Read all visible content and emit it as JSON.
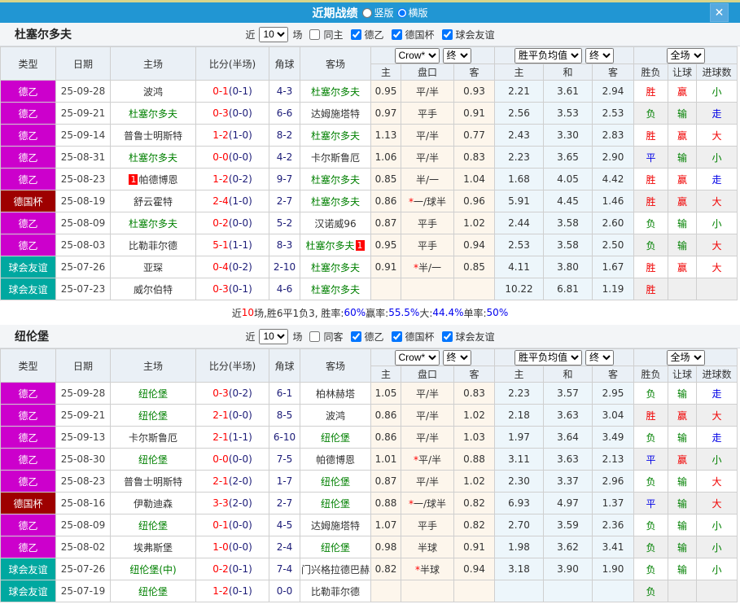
{
  "titlebar": {
    "title": "近期战绩",
    "radio_vertical": "竖版",
    "radio_horizontal": "横版",
    "close_glyph": "✕"
  },
  "type_colors": {
    "德乙": "#CC00CC",
    "德国杯": "#9E0000",
    "球会友谊": "#00A8A0"
  },
  "result_colors": {
    "胜": "#F00000",
    "负": "#008000",
    "平": "#0000E6",
    "赢": "#F00000",
    "输": "#008000",
    "走": "#0000E6",
    "大": "#F00000",
    "小": "#008000"
  },
  "table_header": {
    "cols": [
      "类型",
      "日期",
      "主场",
      "比分(半场)",
      "角球",
      "客场"
    ],
    "odds_select": "Crow*",
    "odds_final": "终",
    "mean_select": "胜平负均值",
    "mean_final": "终",
    "scope_select": "全场",
    "sub": [
      "主",
      "盘口",
      "客",
      "主",
      "和",
      "客",
      "胜负",
      "让球",
      "进球数"
    ]
  },
  "sections": [
    {
      "team": "杜塞尔多夫",
      "filter": {
        "near": "近",
        "games": "10",
        "games_unit": "场",
        "same": "同主",
        "same_checked": false,
        "leagues": [
          {
            "label": "德乙",
            "checked": true
          },
          {
            "label": "德国杯",
            "checked": true
          },
          {
            "label": "球会友谊",
            "checked": true
          }
        ]
      },
      "rows": [
        {
          "type": "德乙",
          "date": "25-09-28",
          "home": "波鸿",
          "home_focus": false,
          "score": "0-1",
          "half": "(0-1)",
          "corner": "4-3",
          "away": "杜塞尔多夫",
          "away_focus": true,
          "odds": [
            "0.95",
            "平/半",
            "0.93"
          ],
          "means": [
            "2.21",
            "3.61",
            "2.94"
          ],
          "results": [
            "胜",
            "赢",
            "小"
          ]
        },
        {
          "type": "德乙",
          "date": "25-09-21",
          "home": "杜塞尔多夫",
          "home_focus": true,
          "score": "0-3",
          "half": "(0-0)",
          "corner": "6-6",
          "away": "达姆施塔特",
          "away_focus": false,
          "odds": [
            "0.97",
            "平手",
            "0.91"
          ],
          "means": [
            "2.56",
            "3.53",
            "2.53"
          ],
          "results": [
            "负",
            "输",
            "走"
          ]
        },
        {
          "type": "德乙",
          "date": "25-09-14",
          "home": "普鲁士明斯特",
          "home_focus": false,
          "score": "1-2",
          "half": "(1-0)",
          "corner": "8-2",
          "away": "杜塞尔多夫",
          "away_focus": true,
          "odds": [
            "1.13",
            "平/半",
            "0.77"
          ],
          "means": [
            "2.43",
            "3.30",
            "2.83"
          ],
          "results": [
            "胜",
            "赢",
            "大"
          ]
        },
        {
          "type": "德乙",
          "date": "25-08-31",
          "home": "杜塞尔多夫",
          "home_focus": true,
          "score": "0-0",
          "half": "(0-0)",
          "corner": "4-2",
          "away": "卡尔斯鲁厄",
          "away_focus": false,
          "odds": [
            "1.06",
            "平/半",
            "0.83"
          ],
          "means": [
            "2.23",
            "3.65",
            "2.90"
          ],
          "results": [
            "平",
            "输",
            "小"
          ]
        },
        {
          "type": "德乙",
          "date": "25-08-23",
          "home": "帕德博恩",
          "home_focus": false,
          "home_badge": "1",
          "home_badge_pos": "before",
          "score": "1-2",
          "half": "(0-2)",
          "corner": "9-7",
          "away": "杜塞尔多夫",
          "away_focus": true,
          "odds": [
            "0.85",
            "半/一",
            "1.04"
          ],
          "means": [
            "1.68",
            "4.05",
            "4.42"
          ],
          "results": [
            "胜",
            "赢",
            "走"
          ]
        },
        {
          "type": "德国杯",
          "date": "25-08-19",
          "home": "舒云霍特",
          "home_focus": false,
          "score": "2-4",
          "half": "(1-0)",
          "corner": "2-7",
          "away": "杜塞尔多夫",
          "away_focus": true,
          "odds": [
            "0.86",
            "*一/球半",
            "0.96"
          ],
          "means": [
            "5.91",
            "4.45",
            "1.46"
          ],
          "results": [
            "胜",
            "赢",
            "大"
          ]
        },
        {
          "type": "德乙",
          "date": "25-08-09",
          "home": "杜塞尔多夫",
          "home_focus": true,
          "score": "0-2",
          "half": "(0-0)",
          "corner": "5-2",
          "away": "汉诺威96",
          "away_focus": false,
          "odds": [
            "0.87",
            "平手",
            "1.02"
          ],
          "means": [
            "2.44",
            "3.58",
            "2.60"
          ],
          "results": [
            "负",
            "输",
            "小"
          ]
        },
        {
          "type": "德乙",
          "date": "25-08-03",
          "home": "比勒菲尔德",
          "home_focus": false,
          "score": "5-1",
          "half": "(1-1)",
          "corner": "8-3",
          "away": "杜塞尔多夫",
          "away_focus": true,
          "away_badge": "1",
          "away_badge_pos": "after",
          "odds": [
            "0.95",
            "平手",
            "0.94"
          ],
          "means": [
            "2.53",
            "3.58",
            "2.50"
          ],
          "results": [
            "负",
            "输",
            "大"
          ]
        },
        {
          "type": "球会友谊",
          "date": "25-07-26",
          "home": "亚琛",
          "home_focus": false,
          "score": "0-4",
          "half": "(0-2)",
          "corner": "2-10",
          "away": "杜塞尔多夫",
          "away_focus": true,
          "odds": [
            "0.91",
            "*半/一",
            "0.85"
          ],
          "means": [
            "4.11",
            "3.80",
            "1.67"
          ],
          "results": [
            "胜",
            "赢",
            "大"
          ]
        },
        {
          "type": "球会友谊",
          "date": "25-07-23",
          "home": "威尔伯特",
          "home_focus": false,
          "score": "0-3",
          "half": "(0-1)",
          "corner": "4-6",
          "away": "杜塞尔多夫",
          "away_focus": true,
          "odds": [
            "",
            "",
            ""
          ],
          "means": [
            "10.22",
            "6.81",
            "1.19"
          ],
          "results": [
            "胜",
            "",
            ""
          ]
        }
      ],
      "summary": [
        {
          "text": "近",
          "color": "#333333"
        },
        {
          "text": "10",
          "color": "#FF0000"
        },
        {
          "text": "场,胜6平1负3, 胜率:",
          "color": "#333333"
        },
        {
          "text": "60%",
          "color": "#0000EE"
        },
        {
          "text": " 赢率:",
          "color": "#333333"
        },
        {
          "text": "55.5%",
          "color": "#0000EE"
        },
        {
          "text": " 大:",
          "color": "#333333"
        },
        {
          "text": "44.4%",
          "color": "#0000EE"
        },
        {
          "text": " 单率:",
          "color": "#333333"
        },
        {
          "text": "50%",
          "color": "#0000EE"
        }
      ]
    },
    {
      "team": "纽伦堡",
      "filter": {
        "near": "近",
        "games": "10",
        "games_unit": "场",
        "same": "同客",
        "same_checked": false,
        "leagues": [
          {
            "label": "德乙",
            "checked": true
          },
          {
            "label": "德国杯",
            "checked": true
          },
          {
            "label": "球会友谊",
            "checked": true
          }
        ]
      },
      "rows": [
        {
          "type": "德乙",
          "date": "25-09-28",
          "home": "纽伦堡",
          "home_focus": true,
          "score": "0-3",
          "half": "(0-2)",
          "corner": "6-1",
          "away": "柏林赫塔",
          "away_focus": false,
          "odds": [
            "1.05",
            "平/半",
            "0.83"
          ],
          "means": [
            "2.23",
            "3.57",
            "2.95"
          ],
          "results": [
            "负",
            "输",
            "走"
          ]
        },
        {
          "type": "德乙",
          "date": "25-09-21",
          "home": "纽伦堡",
          "home_focus": true,
          "score": "2-1",
          "half": "(0-0)",
          "corner": "8-5",
          "away": "波鸿",
          "away_focus": false,
          "odds": [
            "0.86",
            "平/半",
            "1.02"
          ],
          "means": [
            "2.18",
            "3.63",
            "3.04"
          ],
          "results": [
            "胜",
            "赢",
            "大"
          ]
        },
        {
          "type": "德乙",
          "date": "25-09-13",
          "home": "卡尔斯鲁厄",
          "home_focus": false,
          "score": "2-1",
          "half": "(1-1)",
          "corner": "6-10",
          "away": "纽伦堡",
          "away_focus": true,
          "odds": [
            "0.86",
            "平/半",
            "1.03"
          ],
          "means": [
            "1.97",
            "3.64",
            "3.49"
          ],
          "results": [
            "负",
            "输",
            "走"
          ]
        },
        {
          "type": "德乙",
          "date": "25-08-30",
          "home": "纽伦堡",
          "home_focus": true,
          "score": "0-0",
          "half": "(0-0)",
          "corner": "7-5",
          "away": "帕德博恩",
          "away_focus": false,
          "odds": [
            "1.01",
            "*平/半",
            "0.88"
          ],
          "means": [
            "3.11",
            "3.63",
            "2.13"
          ],
          "results": [
            "平",
            "赢",
            "小"
          ]
        },
        {
          "type": "德乙",
          "date": "25-08-23",
          "home": "普鲁士明斯特",
          "home_focus": false,
          "score": "2-1",
          "half": "(2-0)",
          "corner": "1-7",
          "away": "纽伦堡",
          "away_focus": true,
          "odds": [
            "0.87",
            "平/半",
            "1.02"
          ],
          "means": [
            "2.30",
            "3.37",
            "2.96"
          ],
          "results": [
            "负",
            "输",
            "大"
          ]
        },
        {
          "type": "德国杯",
          "date": "25-08-16",
          "home": "伊勒迪森",
          "home_focus": false,
          "score": "3-3",
          "half": "(2-0)",
          "corner": "2-7",
          "away": "纽伦堡",
          "away_focus": true,
          "odds": [
            "0.88",
            "*一/球半",
            "0.82"
          ],
          "means": [
            "6.93",
            "4.97",
            "1.37"
          ],
          "results": [
            "平",
            "输",
            "大"
          ]
        },
        {
          "type": "德乙",
          "date": "25-08-09",
          "home": "纽伦堡",
          "home_focus": true,
          "score": "0-1",
          "half": "(0-0)",
          "corner": "4-5",
          "away": "达姆施塔特",
          "away_focus": false,
          "odds": [
            "1.07",
            "平手",
            "0.82"
          ],
          "means": [
            "2.70",
            "3.59",
            "2.36"
          ],
          "results": [
            "负",
            "输",
            "小"
          ]
        },
        {
          "type": "德乙",
          "date": "25-08-02",
          "home": "埃弗斯堡",
          "home_focus": false,
          "score": "1-0",
          "half": "(0-0)",
          "corner": "2-4",
          "away": "纽伦堡",
          "away_focus": true,
          "odds": [
            "0.98",
            "半球",
            "0.91"
          ],
          "means": [
            "1.98",
            "3.62",
            "3.41"
          ],
          "results": [
            "负",
            "输",
            "小"
          ]
        },
        {
          "type": "球会友谊",
          "date": "25-07-26",
          "home": "纽伦堡(中)",
          "home_focus": true,
          "score": "0-2",
          "half": "(0-1)",
          "corner": "7-4",
          "away": "门兴格拉德巴赫",
          "away_focus": false,
          "odds": [
            "0.82",
            "*半球",
            "0.94"
          ],
          "means": [
            "3.18",
            "3.90",
            "1.90"
          ],
          "results": [
            "负",
            "输",
            "小"
          ]
        },
        {
          "type": "球会友谊",
          "date": "25-07-19",
          "home": "纽伦堡",
          "home_focus": true,
          "score": "1-2",
          "half": "(0-1)",
          "corner": "0-0",
          "away": "比勒菲尔德",
          "away_focus": false,
          "odds": [
            "",
            "",
            ""
          ],
          "means": [
            "",
            "",
            ""
          ],
          "results": [
            "负",
            "",
            ""
          ]
        }
      ],
      "summary": []
    }
  ]
}
